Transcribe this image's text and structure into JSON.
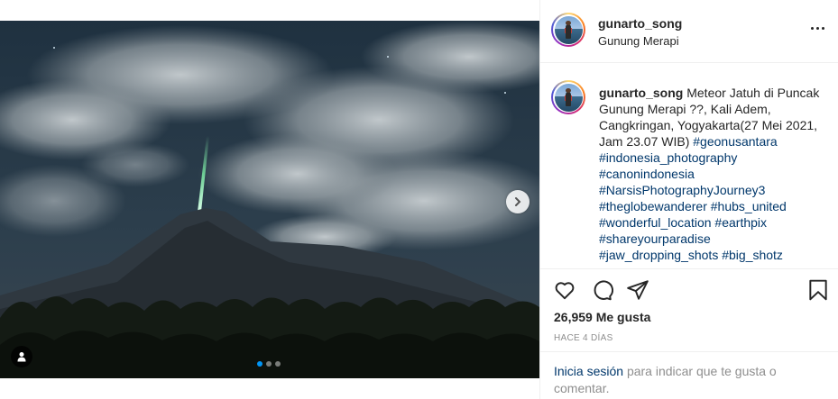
{
  "post": {
    "username": "gunarto_song",
    "location": "Gunung Merapi",
    "caption_text": "Meteor Jatuh di Puncak Gunung Merapi ??, Kali Adem, Cangkringan, Yogyakarta(27 Mei 2021, Jam 23.07 WIB)",
    "hashtags": [
      "#geonusantara",
      "#indonesia_photography",
      "#canonindonesia",
      "#NarsisPhotographyJourney3",
      "#theglobewanderer",
      "#hubs_united",
      "#wonderful_location",
      "#earthpix",
      "#shareyourparadise",
      "#jaw_dropping_shots",
      "#big_shotz"
    ],
    "likes": "26,959 Me gusta",
    "time": "HACE 4 DÍAS",
    "login_link": "Inicia sesión",
    "login_text": "para indicar que te gusta o comentar."
  },
  "carousel": {
    "total": 3,
    "active_index": 0
  },
  "icons": {
    "more": "more-options-icon",
    "heart": "heart-icon",
    "comment": "comment-icon",
    "share": "share-icon",
    "save": "bookmark-icon",
    "next": "chevron-right-icon",
    "user_tag": "user-tag-icon"
  },
  "colors": {
    "link": "#00376b",
    "active_dot": "#0095f6",
    "muted": "#8e8e8e",
    "meteor": "#8cf5b4"
  }
}
